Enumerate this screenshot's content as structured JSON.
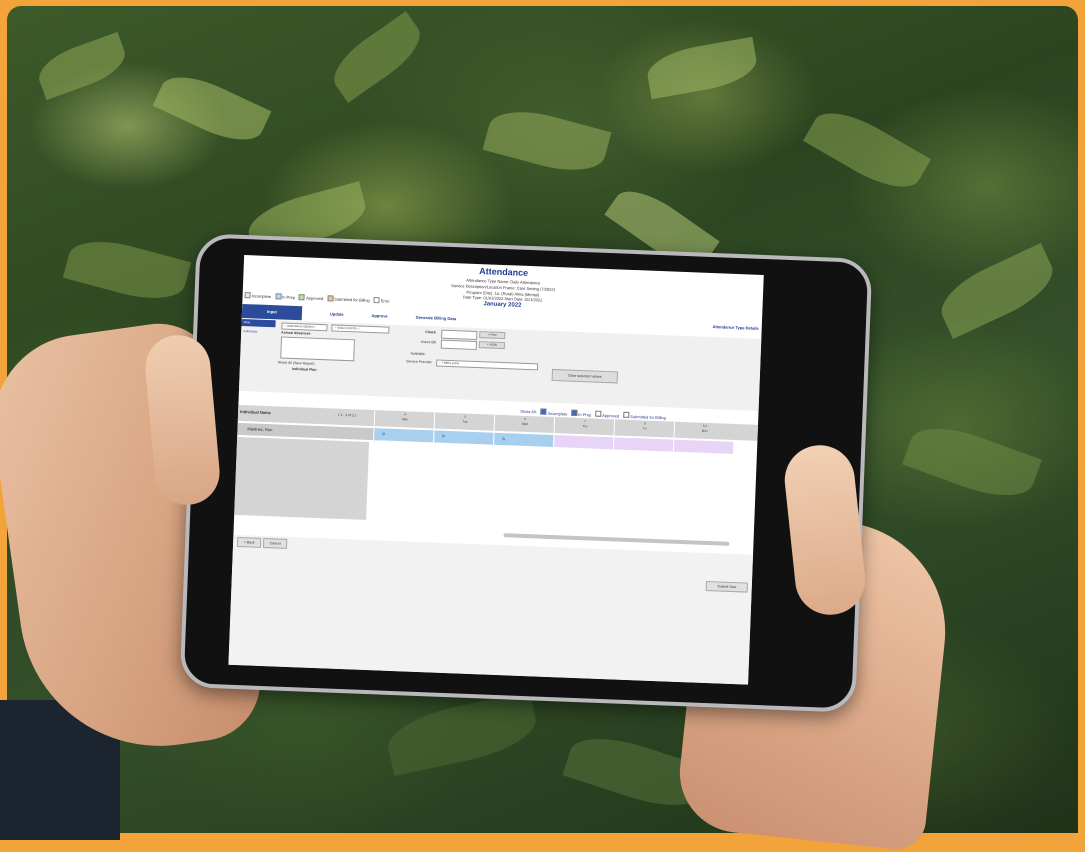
{
  "photo": {
    "subject": "",
    "accent_color": "#f2a33a"
  },
  "attendance": {
    "title": "Attendance",
    "subtitle_lines": [
      "Attendance Type Name: Daily Attendance",
      "Service Description/Location Frame: Care Setting (7/2022)",
      "Program (Site): 1a. (Rural) Alma (Mental)",
      "Date Type: 01/01/2022  Start Date: 01/1/2022"
    ],
    "month": "January 2022",
    "legend": [
      {
        "label": "Incomplete",
        "color": "#dfe7ef"
      },
      {
        "label": "In Prep",
        "color": "#b7d9f2"
      },
      {
        "label": "Approved",
        "color": "#b9e0a5"
      },
      {
        "label": "Submitted for Billing",
        "color": "#f6c48a"
      },
      {
        "label": "Error",
        "color": "#ffffff"
      }
    ],
    "tabs": [
      "Input",
      "Update",
      "Approve",
      "Generate Billing Data"
    ],
    "type_details_link": "Attendance Type Details",
    "panel": {
      "view_label": "View",
      "list_item": "Individuals",
      "select1": "-- Attendance Options --",
      "select2": "-- Select Unit Pts --",
      "annual_absences_label": "Annual Absences",
      "reset_label": "Reset All (Save Report)",
      "individual_plan_label": "Individual Plan",
      "check_label": "Check",
      "check_button": "+ Row",
      "hours_label": "Hours Bill",
      "hours_button": "+ NOW",
      "available_label": "Available:",
      "service_provider_label": "Service Provider",
      "service_provider_value": "-- TIMES (024)",
      "clear_button": "Clear selected values"
    },
    "filters": {
      "show_label": "Show All:",
      "items": [
        {
          "label": "Incomplete",
          "checked": true
        },
        {
          "label": "In Prep",
          "checked": true
        },
        {
          "label": "Approved",
          "checked": false
        },
        {
          "label": "Submitted for Billing",
          "checked": false
        }
      ]
    },
    "grid": {
      "name_header": "Individual Name",
      "count": "( 1 - 1 of 1 )",
      "days": [
        {
          "num": "4",
          "name": "Mon"
        },
        {
          "num": "5",
          "name": "Tue"
        },
        {
          "num": "6",
          "name": "Wed"
        },
        {
          "num": "7",
          "name": "Thu"
        },
        {
          "num": "8",
          "name": "Fri"
        },
        {
          "num": "9-1",
          "name": "Mon"
        }
      ],
      "row_name": "Martinez, Ron",
      "cells": [
        "P",
        "P",
        "A",
        "",
        "",
        ""
      ]
    },
    "buttons": {
      "back": "< Back",
      "cancel": "Cancel",
      "submit": "Submit Now"
    }
  }
}
